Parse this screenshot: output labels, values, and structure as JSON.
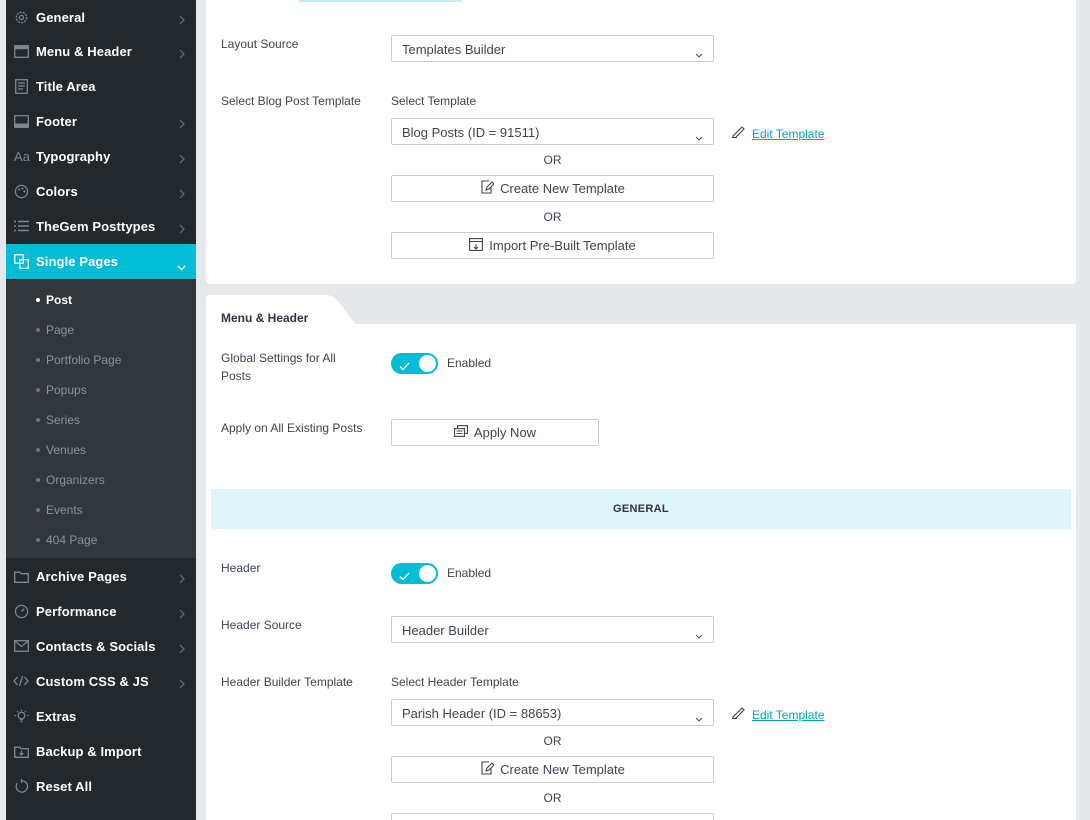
{
  "sidebar": {
    "items": [
      {
        "label": "General",
        "icon": "gear-icon"
      },
      {
        "label": "Menu & Header",
        "icon": "menu-header-icon"
      },
      {
        "label": "Title Area",
        "icon": "title-area-icon"
      },
      {
        "label": "Footer",
        "icon": "footer-icon"
      },
      {
        "label": "Typography",
        "icon": "typography-icon"
      },
      {
        "label": "Colors",
        "icon": "palette-icon"
      },
      {
        "label": "TheGem Posttypes",
        "icon": "list-icon"
      },
      {
        "label": "Single Pages",
        "icon": "single-pages-icon"
      },
      {
        "label": "Archive Pages",
        "icon": "archive-icon"
      },
      {
        "label": "Performance",
        "icon": "gauge-icon"
      },
      {
        "label": "Contacts & Socials",
        "icon": "envelope-icon"
      },
      {
        "label": "Custom CSS & JS",
        "icon": "code-icon"
      },
      {
        "label": "Extras",
        "icon": "bulb-icon"
      },
      {
        "label": "Backup & Import",
        "icon": "backup-icon"
      },
      {
        "label": "Reset All",
        "icon": "reset-icon"
      }
    ],
    "active": "Single Pages",
    "submenu": [
      "Post",
      "Page",
      "Portfolio Page",
      "Popups",
      "Series",
      "Venues",
      "Organizers",
      "Events",
      "404 Page"
    ],
    "submenu_active": "Post"
  },
  "layout": {
    "layout_source_label": "Layout Source",
    "layout_source_value": "Templates Builder",
    "blog_template_label": "Select Blog Post Template",
    "select_template_caption": "Select Template",
    "blog_template_value": "Blog Posts (ID = 91511)",
    "edit_template": "Edit Template",
    "or1": "OR",
    "create_new": "Create New Template",
    "or2": "OR",
    "import_prebuilt": "Import Pre-Built Template"
  },
  "menu_header": {
    "tab_title": "Menu & Header",
    "global_settings_label": "Global Settings for All Posts",
    "global_settings_state": "Enabled",
    "apply_label": "Apply on All Existing Posts",
    "apply_button": "Apply Now",
    "section_general": "GENERAL",
    "header_label": "Header",
    "header_state": "Enabled",
    "header_source_label": "Header Source",
    "header_source_value": "Header Builder",
    "header_builder_label": "Header Builder Template",
    "select_header_caption": "Select Header Template",
    "header_template_value": "Parish Header (ID = 88653)",
    "edit_template": "Edit Template",
    "or1": "OR",
    "create_new": "Create New Template",
    "or2": "OR"
  },
  "colors": {
    "accent": "#00bcd4",
    "sidebar_bg": "#23282d",
    "submenu_bg": "#32373c",
    "section_bg": "#e0f5f9",
    "link": "#00a7bf"
  }
}
